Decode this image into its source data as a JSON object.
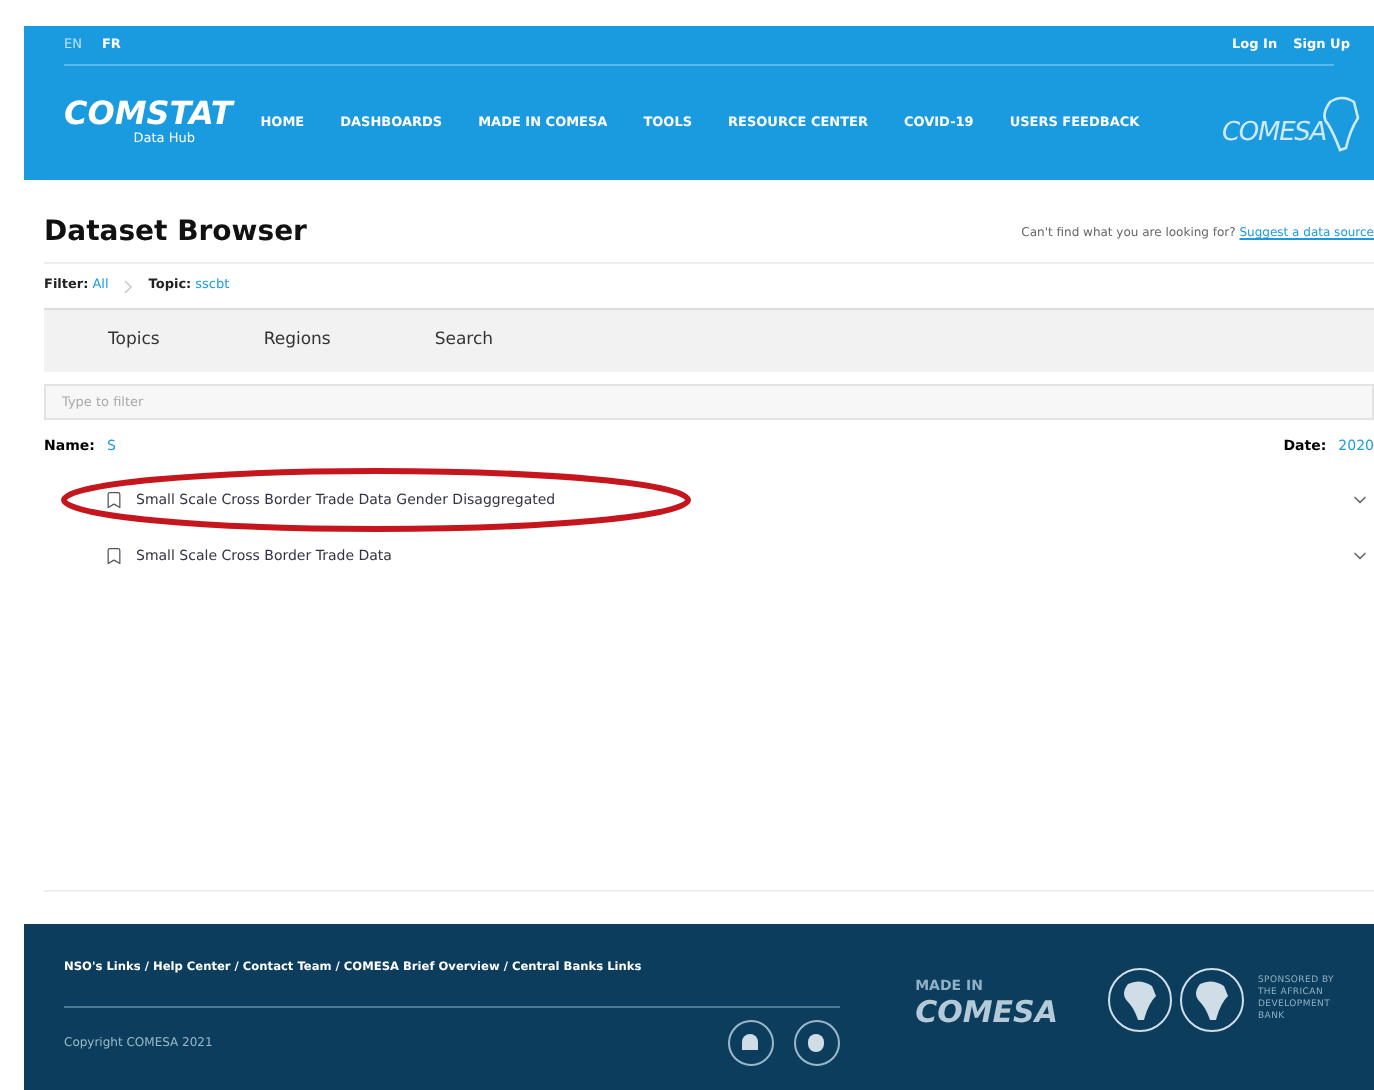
{
  "languages": [
    {
      "label": "EN",
      "selected": false
    },
    {
      "label": "FR",
      "selected": true
    }
  ],
  "account_links": [
    "Log In",
    "Sign Up"
  ],
  "brand": {
    "name": "COMSTAT",
    "subtitle": "Data Hub"
  },
  "nav": [
    "HOME",
    "DASHBOARDS",
    "MADE IN COMESA",
    "TOOLS",
    "RESOURCE CENTER",
    "COVID-19",
    "USERS FEEDBACK"
  ],
  "partner_logo": "COMESA",
  "page_title": "Dataset Browser",
  "suggest": {
    "text": "Can't find what you are looking for?",
    "link": "Suggest a data source"
  },
  "breadcrumb": [
    {
      "label": "Filter:",
      "value": "All"
    },
    {
      "label": "Topic:",
      "value": "sscbt"
    }
  ],
  "tabs": [
    {
      "label": "Topics",
      "selected": false
    },
    {
      "label": "Regions",
      "selected": false
    },
    {
      "label": "Search",
      "selected": false
    }
  ],
  "filter": {
    "placeholder": "Type to filter"
  },
  "sort": {
    "name_label": "Name:",
    "name_value": "S",
    "date_label": "Date:",
    "date_value": "2020"
  },
  "datasets": [
    {
      "title": "Small Scale Cross Border Trade Data Gender Disaggregated",
      "circled": true
    },
    {
      "title": "Small Scale Cross Border Trade Data",
      "circled": false
    }
  ],
  "footer": {
    "links": "NSO's Links / Help Center / Contact Team / COMESA Brief Overview / Central Banks Links",
    "copyright": "Copyright COMESA 2021",
    "made_in": "MADE IN",
    "made_in_brand": "COMESA",
    "sponsor": [
      "SPONSORED BY",
      "THE AFRICAN",
      "DEVELOPMENT",
      "BANK"
    ]
  }
}
